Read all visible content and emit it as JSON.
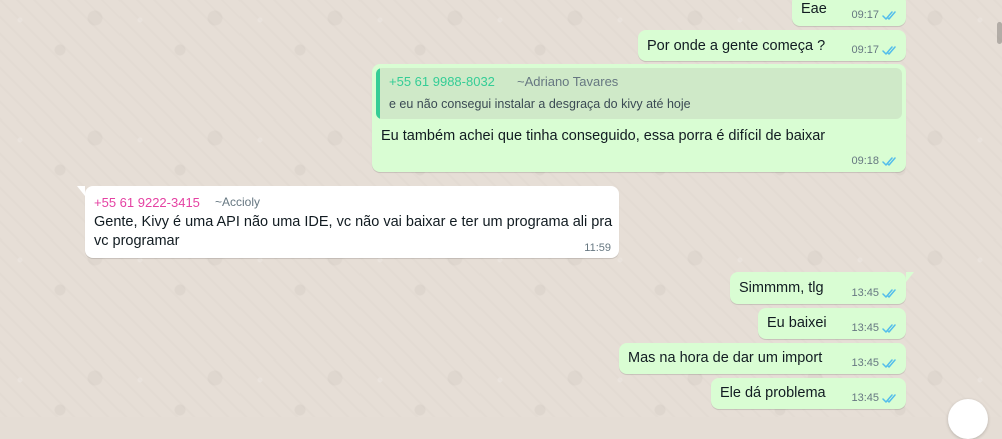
{
  "messages": [
    {
      "text": "Eae",
      "time": "09:17"
    },
    {
      "text": "Por onde a gente começa ?",
      "time": "09:17"
    },
    {
      "quote": {
        "phone": "+55 61 9988-8032",
        "name": "~Adriano Tavares",
        "text": "e eu não consegui instalar a desgraça do kivy até hoje"
      },
      "text": "Eu também achei que tinha conseguido, essa porra é difícil de baixar",
      "time": "09:18"
    },
    {
      "sender_phone": "+55 61 9222-3415",
      "sender_name": "~Accioly",
      "line1": "Gente, Kivy é uma API não uma IDE, vc não vai baixar e ter um programa ali pra",
      "line2": "vc programar",
      "time": "11:59"
    },
    {
      "text": "Simmmm, tlg",
      "time": "13:45"
    },
    {
      "text": "Eu baixei",
      "time": "13:45"
    },
    {
      "text": "Mas na hora de dar um import",
      "time": "13:45"
    },
    {
      "text": "Ele dá problema",
      "time": "13:45"
    }
  ],
  "colors": {
    "outgoing_bubble": "#d9fdd3",
    "incoming_bubble": "#ffffff",
    "read_check": "#53bdeb",
    "sender_phone": "#e542a3",
    "quote_phone": "#35cd96"
  },
  "icons": {
    "read_receipt": "double-check-icon",
    "scroll_down": "scroll-down-button"
  }
}
